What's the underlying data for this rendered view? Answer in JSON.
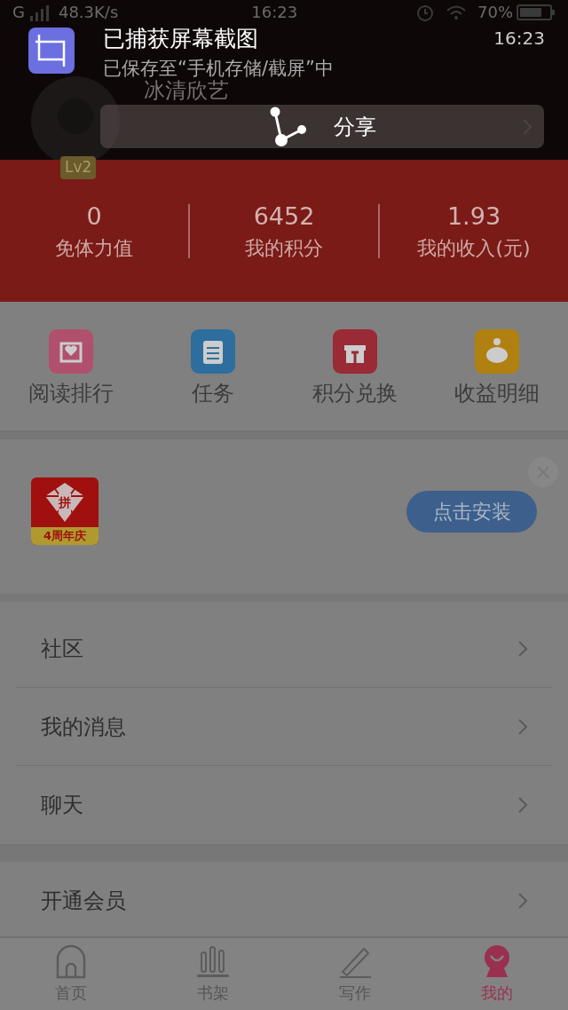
{
  "status_bar": {
    "network": "G",
    "speed": "48.3K/s",
    "time": "16:23",
    "battery": "70%"
  },
  "notification": {
    "title": "已捕获屏幕截图",
    "time": "16:23",
    "message": "已保存至“手机存储/截屏”中",
    "action": "分享"
  },
  "profile": {
    "username": "冰清欣艺",
    "level": "Lv2"
  },
  "stats": [
    {
      "value": "0",
      "label": "免体力值"
    },
    {
      "value": "6452",
      "label": "我的积分"
    },
    {
      "value": "1.93",
      "label": "我的收入(元)"
    }
  ],
  "shortcuts": [
    {
      "label": "阅读排行",
      "kind": "ranking",
      "color": "#b0506e"
    },
    {
      "label": "任务",
      "kind": "task",
      "color": "#2e6e9e"
    },
    {
      "label": "积分兑换",
      "kind": "gift",
      "color": "#9a2a35"
    },
    {
      "label": "收益明细",
      "kind": "piggy",
      "color": "#b08010"
    }
  ],
  "ad": {
    "logo_text": "拼",
    "badge": "4周年庆",
    "button": "点击安装"
  },
  "menu": [
    {
      "label": "社区"
    },
    {
      "label": "我的消息"
    },
    {
      "label": "聊天"
    }
  ],
  "menu_2": [
    {
      "label": "开通会员"
    }
  ],
  "tabs": [
    {
      "label": "首页",
      "kind": "home",
      "selected": false
    },
    {
      "label": "书架",
      "kind": "shelf",
      "selected": false
    },
    {
      "label": "写作",
      "kind": "write",
      "selected": false
    },
    {
      "label": "我的",
      "kind": "me",
      "selected": true
    }
  ]
}
